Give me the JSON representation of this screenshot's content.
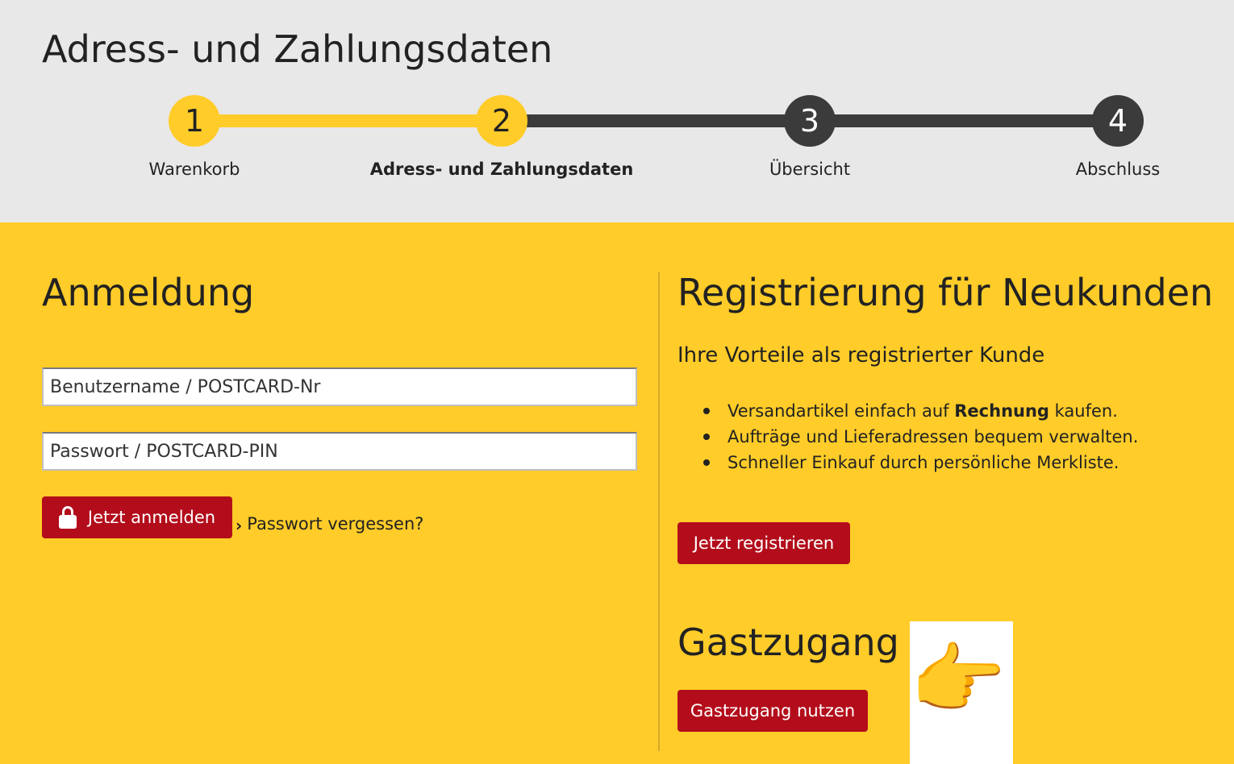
{
  "header": {
    "title": "Adress- und Zahlungsdaten"
  },
  "steps": [
    {
      "number": "1",
      "label": "Warenkorb",
      "state": "done"
    },
    {
      "number": "2",
      "label": "Adress- und Zahlungsdaten",
      "state": "active"
    },
    {
      "number": "3",
      "label": "Übersicht",
      "state": "todo"
    },
    {
      "number": "4",
      "label": "Abschluss",
      "state": "todo"
    }
  ],
  "login": {
    "title": "Anmeldung",
    "username_placeholder": "Benutzername / POSTCARD-Nr",
    "password_placeholder": "Passwort / POSTCARD-PIN",
    "submit_label": "Jetzt anmelden",
    "submit_icon": "lock-icon",
    "forgot_label": "Passwort vergessen?",
    "forgot_icon": "chevron-right-icon"
  },
  "register": {
    "title": "Registrierung für Neukunden",
    "subtitle": "Ihre Vorteile als registrierter Kunde",
    "benefits": [
      {
        "before": "Versandartikel einfach auf ",
        "bold": "Rechnung",
        "after": " kaufen."
      },
      {
        "before": "Aufträge und Lieferadressen bequem verwalten.",
        "bold": "",
        "after": ""
      },
      {
        "before": "Schneller Einkauf durch persönliche Merkliste.",
        "bold": "",
        "after": ""
      }
    ],
    "button_label": "Jetzt registrieren"
  },
  "guest": {
    "title": "Gastzugang",
    "button_label": "Gastzugang nutzen",
    "hand_icon": "pointing-hand-icon",
    "hand_glyph": "👉"
  },
  "colors": {
    "brand_yellow": "#ffcc29",
    "brand_red": "#b30d1b",
    "header_gray": "#e8e8e8",
    "step_dark": "#3b3b3b"
  }
}
